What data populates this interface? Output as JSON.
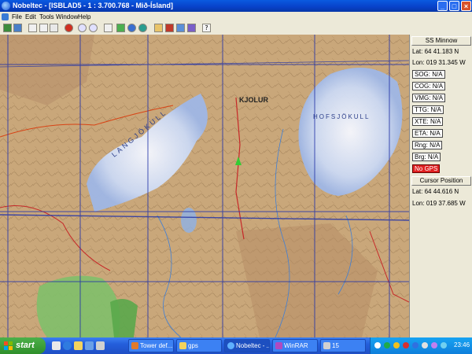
{
  "window": {
    "title": "Nobeltec - [ISBLAD5 - 1 : 3.700.768 - Mið-Ísland]",
    "controls": [
      "_",
      "□",
      "×"
    ]
  },
  "menu": [
    "File",
    "Edit",
    "Tools",
    "Window",
    "Help"
  ],
  "toolbar": {
    "icons": [
      "open-chart-icon",
      "chart-tools-icon",
      "chart-select-icon",
      "route-icon",
      "properties-icon",
      "stop-icon",
      "zoom-in-icon",
      "zoom-out-icon",
      "pencil-icon",
      "measure-icon",
      "target-icon",
      "globe-icon",
      "hand-icon",
      "flag-icon",
      "chart-window-icon",
      "layers-icon",
      "help-icon"
    ]
  },
  "map": {
    "labels": {
      "kjolur": "KJOLUR",
      "hofsjokull": "HOFSJÖKULL",
      "langjokull": "LANGJÖKULL"
    },
    "vessel_icon": "boat-icon"
  },
  "panel": {
    "vessel_name": "SS Minnow",
    "lat_label": "Lat:",
    "lat": "64 41.183 N",
    "lon_label": "Lon:",
    "lon": "019 31.345 W",
    "fields": [
      {
        "label": "SOG:",
        "value": "N/A"
      },
      {
        "label": "COG:",
        "value": "N/A"
      },
      {
        "label": "VMG:",
        "value": "N/A"
      },
      {
        "label": "TTG:",
        "value": "N/A"
      },
      {
        "label": "XTE:",
        "value": "N/A"
      },
      {
        "label": "ETA:",
        "value": "N/A"
      },
      {
        "label": "Rng:",
        "value": "N/A"
      },
      {
        "label": "Brg:",
        "value": "N/A"
      }
    ],
    "gps_status": "No GPS",
    "cursor_title": "Cursor Position",
    "cursor_lat": "64 44.616 N",
    "cursor_lon": "019 37.685 W"
  },
  "taskbar": {
    "start": "start",
    "buttons": [
      {
        "label": "Tower def..."
      },
      {
        "label": "gps"
      },
      {
        "label": "Nobeltec - ..."
      },
      {
        "label": "WinRAR"
      },
      {
        "label": "15"
      }
    ],
    "clock": "23:46"
  }
}
